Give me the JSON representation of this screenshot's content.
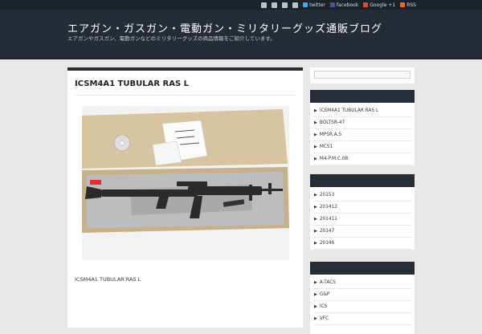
{
  "topbar": {
    "links": [
      {
        "label": "",
        "icon": "mail-icon"
      },
      {
        "label": "",
        "icon": "user-icon"
      },
      {
        "label": "",
        "icon": "home-icon"
      },
      {
        "label": "",
        "icon": "grid-icon"
      },
      {
        "label": "twitter",
        "icon": "twitter-icon",
        "color": "#3fa9f5"
      },
      {
        "label": "facebook",
        "icon": "facebook-icon",
        "color": "#3b5998"
      },
      {
        "label": "Google +1",
        "icon": "google-plus-icon",
        "color": "#dd4b39"
      },
      {
        "label": "RSS",
        "icon": "rss-icon",
        "color": "#f26522"
      }
    ]
  },
  "header": {
    "title": "エアガン・ガスガン・電動ガン・ミリタリーグッズ通販ブログ",
    "description": "エアガンやガスガン、電動ガンなどのミリタリーグッズの商品情報をご紹介しています。"
  },
  "post": {
    "title": "ICSM4A1 TUBULAR RAS L",
    "caption": "ICSM4A1 TUBULAR RAS L",
    "image_alt": "ICSM4A1 TUBULAR RAS L product box photo"
  },
  "sidebar": {
    "search_placeholder": "",
    "recent": {
      "title": "",
      "items": [
        "ICSM4A1 TUBULAR RAS L",
        "BOLTSR-47",
        "MPSR.A.S",
        "MC51",
        "M4-P.M.C.08"
      ]
    },
    "archives": {
      "title": "",
      "items": [
        "20153",
        "201412",
        "201411",
        "20147",
        "20146"
      ]
    },
    "categories": {
      "title": "",
      "items": [
        "A-TACS",
        "G&P",
        "ICS",
        "VFC"
      ]
    }
  },
  "colors": {
    "header_bg": "#252c35",
    "topbar_bg": "#1b222a",
    "widget_head_bg": "#262d36",
    "page_bg": "#e8e8e8"
  }
}
